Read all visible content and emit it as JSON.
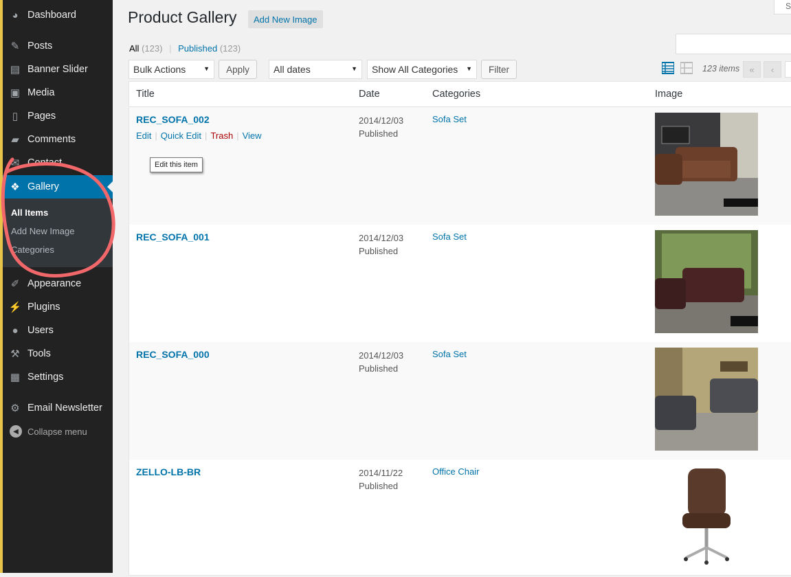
{
  "sidebar": {
    "items": [
      {
        "label": "Dashboard",
        "icon": "dashboard-icon"
      },
      {
        "label": "Posts",
        "icon": "pin-icon"
      },
      {
        "label": "Banner Slider",
        "icon": "slider-icon"
      },
      {
        "label": "Media",
        "icon": "media-icon"
      },
      {
        "label": "Pages",
        "icon": "pages-icon"
      },
      {
        "label": "Comments",
        "icon": "comments-icon"
      },
      {
        "label": "Contact",
        "icon": "mail-icon"
      },
      {
        "label": "Gallery",
        "icon": "gallery-icon"
      },
      {
        "label": "Appearance",
        "icon": "brush-icon"
      },
      {
        "label": "Plugins",
        "icon": "plug-icon"
      },
      {
        "label": "Users",
        "icon": "user-icon"
      },
      {
        "label": "Tools",
        "icon": "wrench-icon"
      },
      {
        "label": "Settings",
        "icon": "settings-icon"
      },
      {
        "label": "Email Newsletter",
        "icon": "gear-icon"
      }
    ],
    "submenu": [
      "All Items",
      "Add New Image",
      "Categories"
    ],
    "collapse": "Collapse menu"
  },
  "header": {
    "title": "Product Gallery",
    "add_new": "Add New Image",
    "screen_options": "Sc"
  },
  "views": {
    "all": "All",
    "all_count": "(123)",
    "sep": "|",
    "published": "Published",
    "published_count": "(123)"
  },
  "filters": {
    "bulk_actions": "Bulk Actions",
    "apply": "Apply",
    "dates": "All dates",
    "categories": "Show All Categories",
    "filter": "Filter"
  },
  "pagination": {
    "items": "123 items",
    "first": "«",
    "prev": "‹"
  },
  "table": {
    "columns": [
      "Title",
      "Date",
      "Categories",
      "Image"
    ],
    "rows": [
      {
        "title": "REC_SOFA_002",
        "date": "2014/12/03",
        "status": "Published",
        "category": "Sofa Set"
      },
      {
        "title": "REC_SOFA_001",
        "date": "2014/12/03",
        "status": "Published",
        "category": "Sofa Set"
      },
      {
        "title": "REC_SOFA_000",
        "date": "2014/12/03",
        "status": "Published",
        "category": "Sofa Set"
      },
      {
        "title": "ZELLO-LB-BR",
        "date": "2014/11/22",
        "status": "Published",
        "category": "Office Chair"
      }
    ],
    "row_actions": {
      "edit": "Edit",
      "quick_edit": "Quick Edit",
      "trash": "Trash",
      "view": "View"
    }
  },
  "tooltip": "Edit this item",
  "colors": {
    "accent": "#0073aa",
    "sidebar": "#222222",
    "annotation": "#f2686a"
  }
}
